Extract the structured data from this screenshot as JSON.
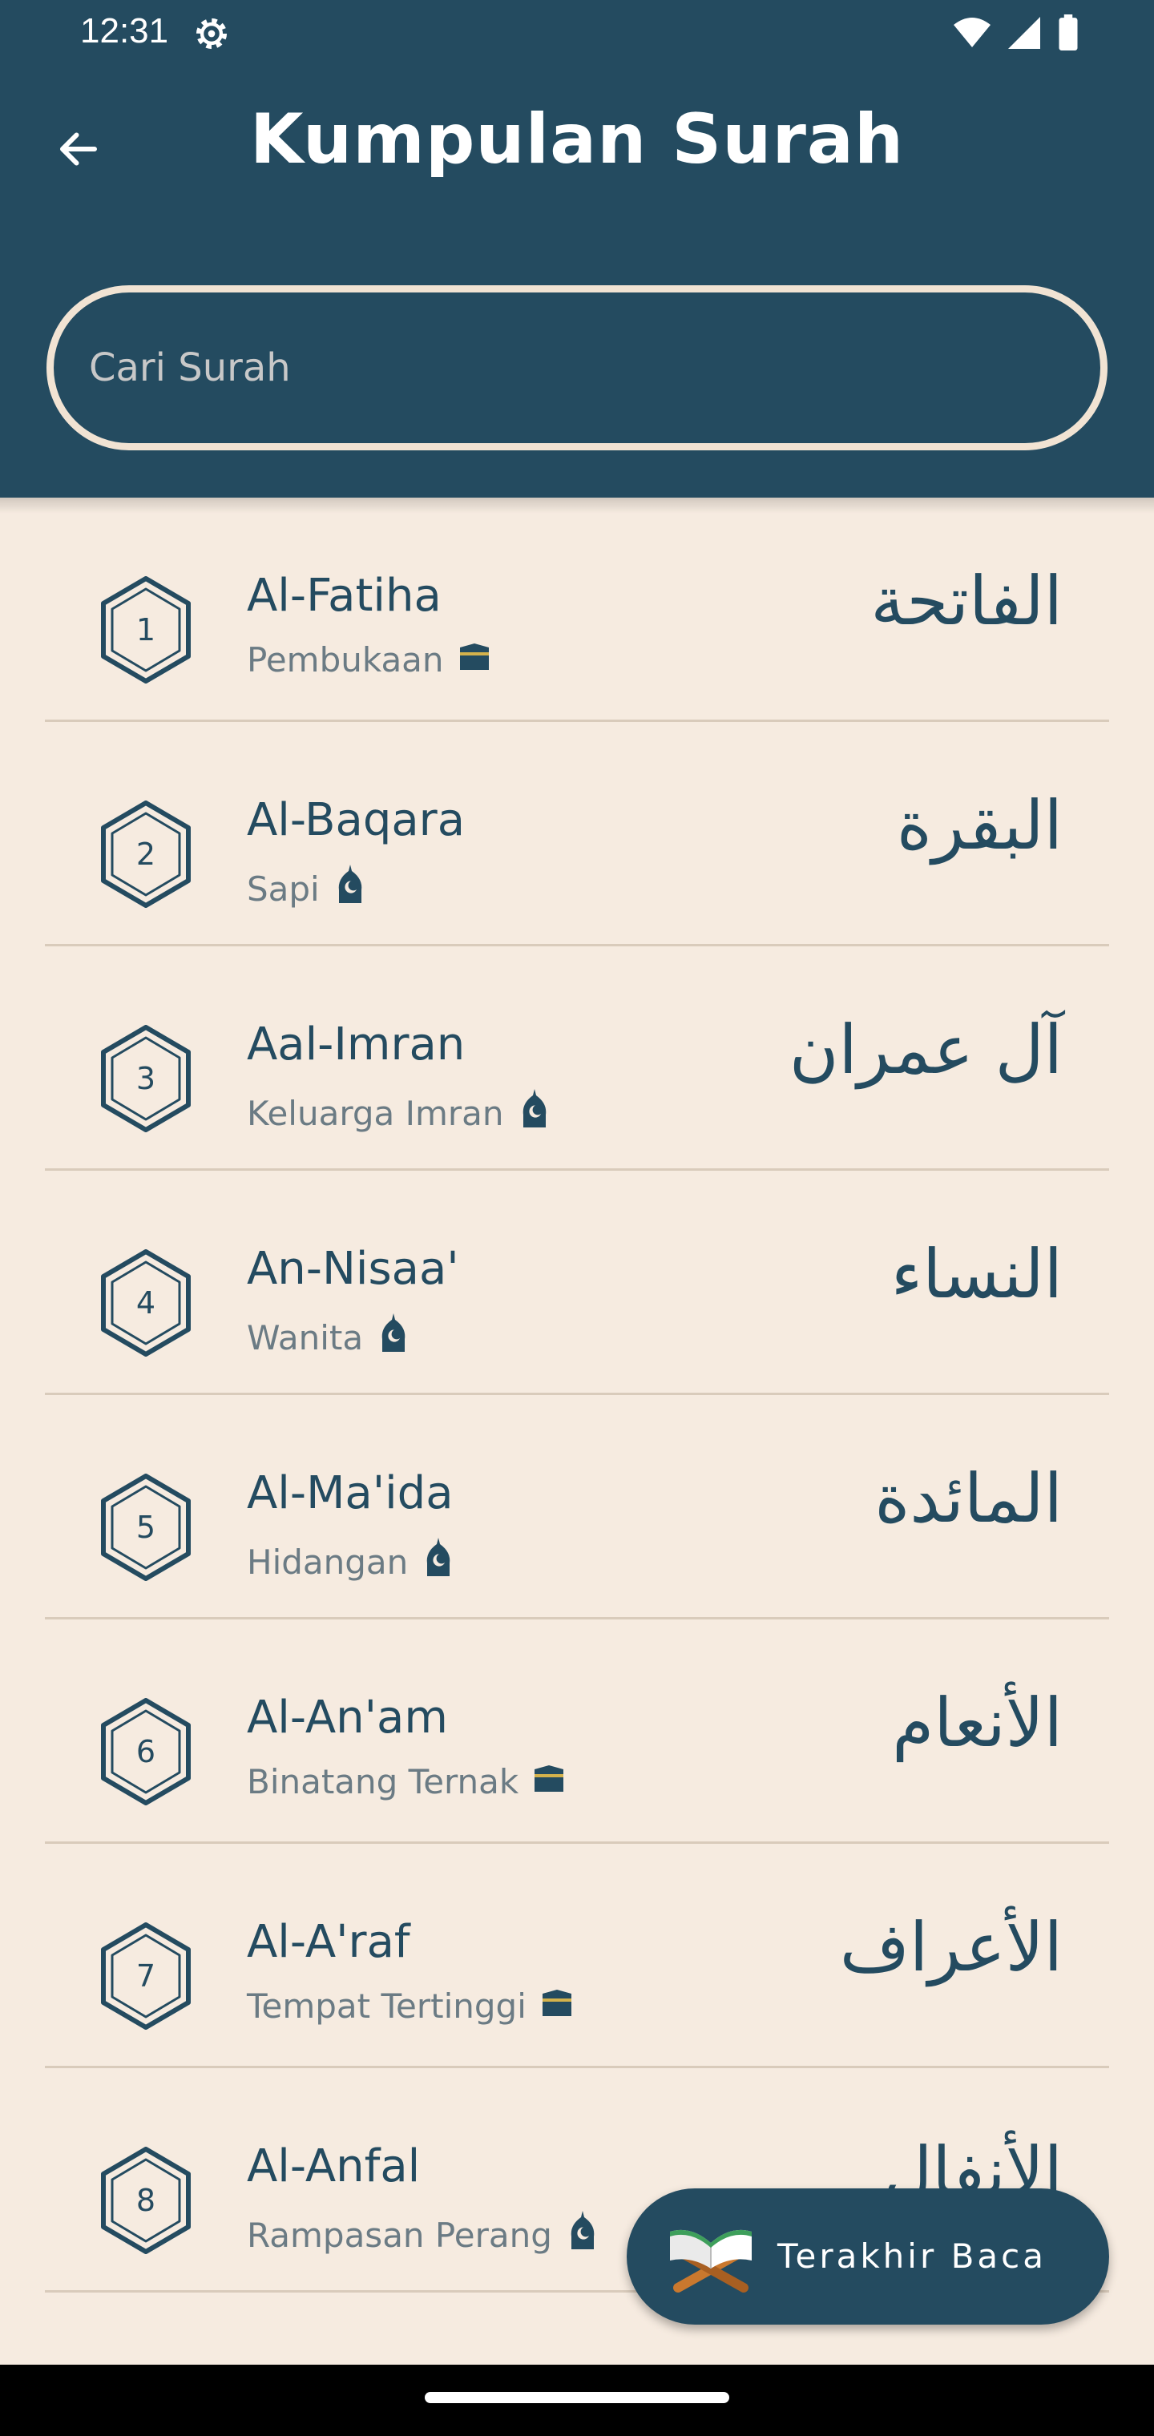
{
  "status": {
    "time": "12:31"
  },
  "header": {
    "title": "Kumpulan Surah"
  },
  "search": {
    "placeholder": "Cari Surah"
  },
  "surahs": [
    {
      "number": "1",
      "latin": "Al-Fatiha",
      "meaning": "Pembukaan",
      "type_icon": "kaaba-icon",
      "arabic": "الفاتحة"
    },
    {
      "number": "2",
      "latin": "Al-Baqara",
      "meaning": "Sapi",
      "type_icon": "mosque-icon",
      "arabic": "البقرة"
    },
    {
      "number": "3",
      "latin": "Aal-Imran",
      "meaning": "Keluarga Imran",
      "type_icon": "mosque-icon",
      "arabic": "آل عمران"
    },
    {
      "number": "4",
      "latin": "An-Nisaa'",
      "meaning": "Wanita",
      "type_icon": "mosque-icon",
      "arabic": "النساء"
    },
    {
      "number": "5",
      "latin": "Al-Ma'ida",
      "meaning": "Hidangan",
      "type_icon": "mosque-icon",
      "arabic": "المائدة"
    },
    {
      "number": "6",
      "latin": "Al-An'am",
      "meaning": "Binatang Ternak",
      "type_icon": "kaaba-icon",
      "arabic": "الأنعام"
    },
    {
      "number": "7",
      "latin": "Al-A'raf",
      "meaning": "Tempat Tertinggi",
      "type_icon": "kaaba-icon",
      "arabic": "الأعراف"
    },
    {
      "number": "8",
      "latin": "Al-Anfal",
      "meaning": "Rampasan Perang",
      "type_icon": "mosque-icon",
      "arabic": "الأنفال"
    }
  ],
  "fab": {
    "label": "Terakhir Baca",
    "icon": "quran-stand-icon"
  },
  "colors": {
    "primary": "#244b60",
    "background": "#f6ebe0",
    "divider": "#d9cbbb",
    "search_border": "#f1e3d3"
  }
}
